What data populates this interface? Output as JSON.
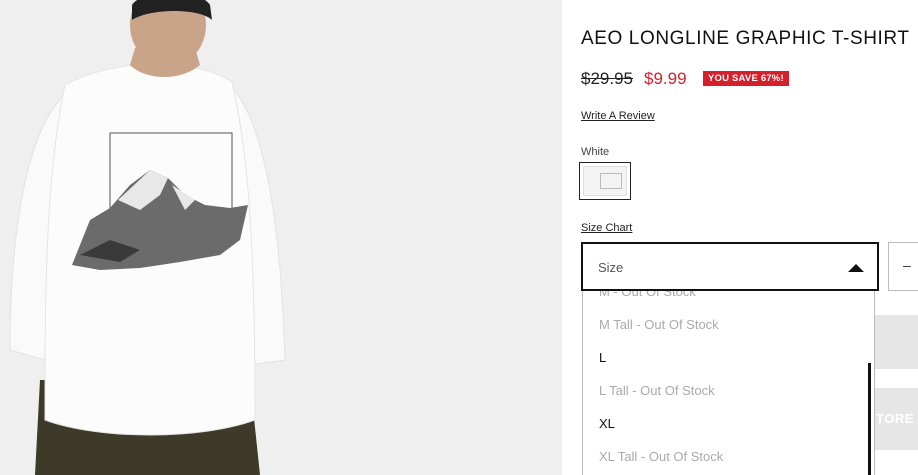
{
  "product": {
    "title": "AEO LONGLINE GRAPHIC T-SHIRT",
    "price_original": "$29.95",
    "price_sale": "$9.99",
    "save_badge": "YOU SAVE 67%!",
    "review_link": "Write A Review",
    "color_label": "White",
    "size_chart_link": "Size Chart"
  },
  "size_select": {
    "label": "Size",
    "options": [
      {
        "label": "M - Out Of Stock",
        "available": false
      },
      {
        "label": "M Tall - Out Of Stock",
        "available": false
      },
      {
        "label": "L",
        "available": true
      },
      {
        "label": "L Tall - Out Of Stock",
        "available": false
      },
      {
        "label": "XL",
        "available": true
      },
      {
        "label": "XL Tall - Out Of Stock",
        "available": false
      }
    ]
  },
  "quantity": {
    "minus_symbol": "–"
  },
  "partial_button_text": "TORE",
  "colors": {
    "sale_red": "#d61f2a",
    "text": "#111111",
    "out_of_stock": "#aaaaaa"
  }
}
